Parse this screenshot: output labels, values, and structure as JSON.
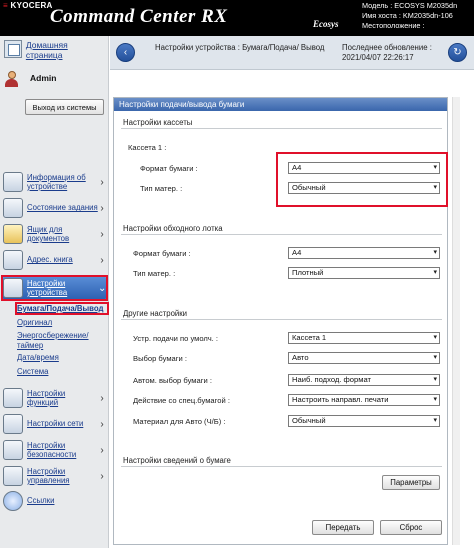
{
  "header": {
    "brand": "KYOCERA",
    "product": "Command Center RX",
    "ecosys": "Ecosys",
    "device_lines": [
      "Модель : ECOSYS M2035dn",
      "Имя хоста : KM2035dn-106",
      "Местоположение :"
    ]
  },
  "sidebar": {
    "home_label": "Домашняя страница",
    "user_label": "Admin",
    "logout_label": "Выход из системы",
    "menu": [
      {
        "label": "Информация об устройстве",
        "icon": "device-info-icon"
      },
      {
        "label": "Состояние задания",
        "icon": "job-status-icon"
      },
      {
        "label": "Ящик для документов",
        "icon": "document-box-icon"
      },
      {
        "label": "Адрес. книга",
        "icon": "address-book-icon"
      },
      {
        "label": "Настройки устройства",
        "icon": "device-settings-icon"
      },
      {
        "label": "Настройки функций",
        "icon": "function-settings-icon"
      },
      {
        "label": "Настройки сети",
        "icon": "network-settings-icon"
      },
      {
        "label": "Настройки безопасности",
        "icon": "security-settings-icon"
      },
      {
        "label": "Настройки управления",
        "icon": "management-settings-icon"
      },
      {
        "label": "Ссылки",
        "icon": "links-icon"
      }
    ],
    "submenu": [
      "Бумага/Подача/Вывод",
      "Оригинал",
      "Энергосбережение/",
      "таймер",
      "Дата/время",
      "Система"
    ]
  },
  "navbar": {
    "breadcrumb": "Настройки устройства : Бумага/Подача/ Вывод",
    "update_label": "Последнее обновление :",
    "update_time": "2021/04/07 22:26:17"
  },
  "main": {
    "title": "Настройки подачи/вывода бумаги",
    "cassette": {
      "section_title": "Настройки кассеты",
      "cassette1_label": "Кассета 1 :",
      "paper_size_label": "Формат бумаги :",
      "paper_size_value": "A4",
      "media_type_label": "Тип матер. :",
      "media_type_value": "Обычный"
    },
    "bypass": {
      "section_title": "Настройки обходного лотка",
      "paper_size_label": "Формат бумаги :",
      "paper_size_value": "A4",
      "media_type_label": "Тип матер. :",
      "media_type_value": "Плотный"
    },
    "other": {
      "section_title": "Другие настройки",
      "rows": [
        {
          "label": "Устр. подачи по умолч. :",
          "value": "Кассета 1"
        },
        {
          "label": "Выбор бумаги :",
          "value": "Авто"
        },
        {
          "label": "Автом. выбор бумаги :",
          "value": "Наиб. подход. формат"
        },
        {
          "label": "Действие со спец.бумагой :",
          "value": "Настроить направл. печати"
        },
        {
          "label": "Материал для Авто (Ч/Б) :",
          "value": "Обычный"
        }
      ]
    },
    "paper_info": {
      "section_title": "Настройки сведений о бумаге",
      "params_button": "Параметры"
    },
    "submit_button": "Передать",
    "reset_button": "Сброс"
  }
}
